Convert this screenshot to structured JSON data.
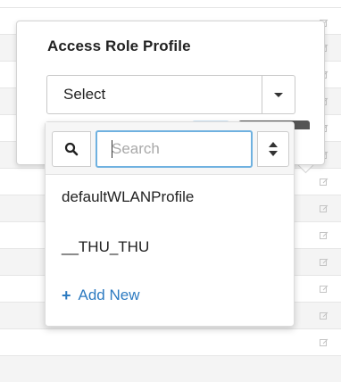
{
  "popover": {
    "title": "Access Role Profile",
    "select_value": "Select"
  },
  "dropdown": {
    "search_placeholder": "Search",
    "options": [
      "defaultWLANProfile",
      "__THU_THU"
    ],
    "add_new_label": "Add New"
  },
  "icons": {
    "search": "search-icon",
    "sort": "sort-icon",
    "caret": "chevron-down-icon",
    "add": "plus-icon",
    "edit": "edit-icon"
  },
  "colors": {
    "accent": "#2d7bc1",
    "focus_border": "#6fb1e0"
  }
}
